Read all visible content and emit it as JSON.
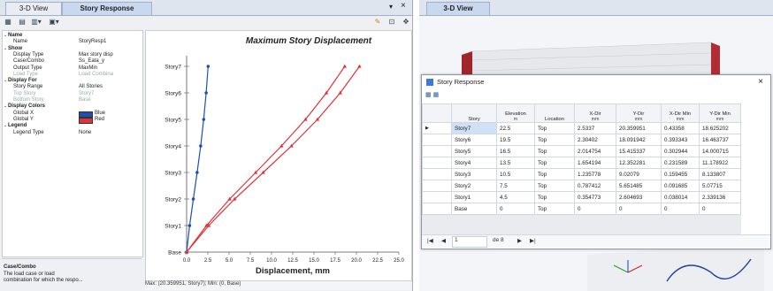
{
  "left_tabs": [
    "3-D View",
    "Story Response"
  ],
  "window_controls": {
    "pin": "▾",
    "close": "×"
  },
  "props": [
    {
      "type": "sec",
      "k": "Name"
    },
    {
      "k": "Name",
      "v": "StoryResp1"
    },
    {
      "type": "sec",
      "k": "Show"
    },
    {
      "k": "Display Type",
      "v": "Max story disp"
    },
    {
      "k": "Case/Combo",
      "v": "Ss_Eata_y"
    },
    {
      "k": "Output Type",
      "v": "MaxMin"
    },
    {
      "k": "Load Type",
      "v": "Load Combina",
      "dis": true
    },
    {
      "type": "sec",
      "k": "Display For"
    },
    {
      "k": "Story Range",
      "v": "All Stories"
    },
    {
      "k": "Top Story",
      "v": "Story7",
      "dis": true
    },
    {
      "k": "Bottom Story",
      "v": "Base",
      "dis": true
    },
    {
      "type": "sec",
      "k": "Display Colors"
    },
    {
      "k": "Global X",
      "v": "Blue",
      "swatch": "#1f4fb5"
    },
    {
      "k": "Global Y",
      "v": "Red",
      "swatch": "#e0323a"
    },
    {
      "type": "sec",
      "k": "Legend"
    },
    {
      "k": "Legend Type",
      "v": "None"
    }
  ],
  "desc": {
    "title": "Case/Combo",
    "line1": "The load case or load",
    "line2": "combination for which the respo..."
  },
  "status": "Max: (20.359951, Story7);   Min: (0, Base)",
  "chart_data": {
    "type": "line",
    "title": "Maximum Story Displacement",
    "xlabel": "Displacement, mm",
    "ylabel": "",
    "stories": [
      "Base",
      "Story1",
      "Story2",
      "Story3",
      "Story4",
      "Story5",
      "Story6",
      "Story7"
    ],
    "x_ticks": [
      "0.0",
      "2.5",
      "5.0",
      "7.5",
      "10.0",
      "12.5",
      "15.0",
      "17.5",
      "20.0",
      "22.5",
      "25.0"
    ],
    "xlim": [
      0,
      25
    ],
    "series": [
      {
        "name": "Global X",
        "color": "#1f4fb5",
        "values": [
          0,
          0.354773,
          0.787412,
          1.235778,
          1.654194,
          2.014754,
          2.30402,
          2.5337
        ]
      },
      {
        "name": "Global Y",
        "color": "#e0323a",
        "values": [
          0,
          2.604693,
          5.651485,
          9.02079,
          12.352281,
          15.415337,
          18.091942,
          20.359951
        ]
      },
      {
        "name": "Global Y",
        "color": "#e0323a",
        "values": [
          0,
          2.339136,
          5.07715,
          8.133807,
          11.178922,
          14.000715,
          16.463737,
          18.625202
        ]
      }
    ]
  },
  "right_tab": "3-D View",
  "dialog": {
    "title": "Story Response",
    "close": "×",
    "headers": [
      {
        "t": "Story",
        "u": ""
      },
      {
        "t": "Elevation",
        "u": "m"
      },
      {
        "t": "Location",
        "u": ""
      },
      {
        "t": "X-Dir",
        "u": "mm"
      },
      {
        "t": "Y-Dir",
        "u": "mm"
      },
      {
        "t": "X-Dir Min",
        "u": "mm"
      },
      {
        "t": "Y-Dir Min",
        "u": "mm"
      }
    ],
    "rows": [
      [
        "Story7",
        "22.5",
        "Top",
        "2.5337",
        "20.359951",
        "0.43358",
        "18.625202"
      ],
      [
        "Story6",
        "19.5",
        "Top",
        "2.30402",
        "18.091942",
        "0.393343",
        "16.463737"
      ],
      [
        "Story5",
        "16.5",
        "Top",
        "2.014754",
        "15.415337",
        "0.302944",
        "14.000715"
      ],
      [
        "Story4",
        "13.5",
        "Top",
        "1.654194",
        "12.352281",
        "0.231589",
        "11.178922"
      ],
      [
        "Story3",
        "10.5",
        "Top",
        "1.235778",
        "9.02079",
        "0.159455",
        "8.133807"
      ],
      [
        "Story2",
        "7.5",
        "Top",
        "0.787412",
        "5.651485",
        "0.091685",
        "5.07715"
      ],
      [
        "Story1",
        "4.5",
        "Top",
        "0.354773",
        "2.604693",
        "0.038014",
        "2.339136"
      ],
      [
        "Base",
        "0",
        "Top",
        "0",
        "0",
        "0",
        "0"
      ]
    ],
    "nav": {
      "first": "|◀",
      "prev": "◀",
      "page": "1",
      "of": "de 8",
      "next": "▶",
      "last": "▶|"
    }
  }
}
